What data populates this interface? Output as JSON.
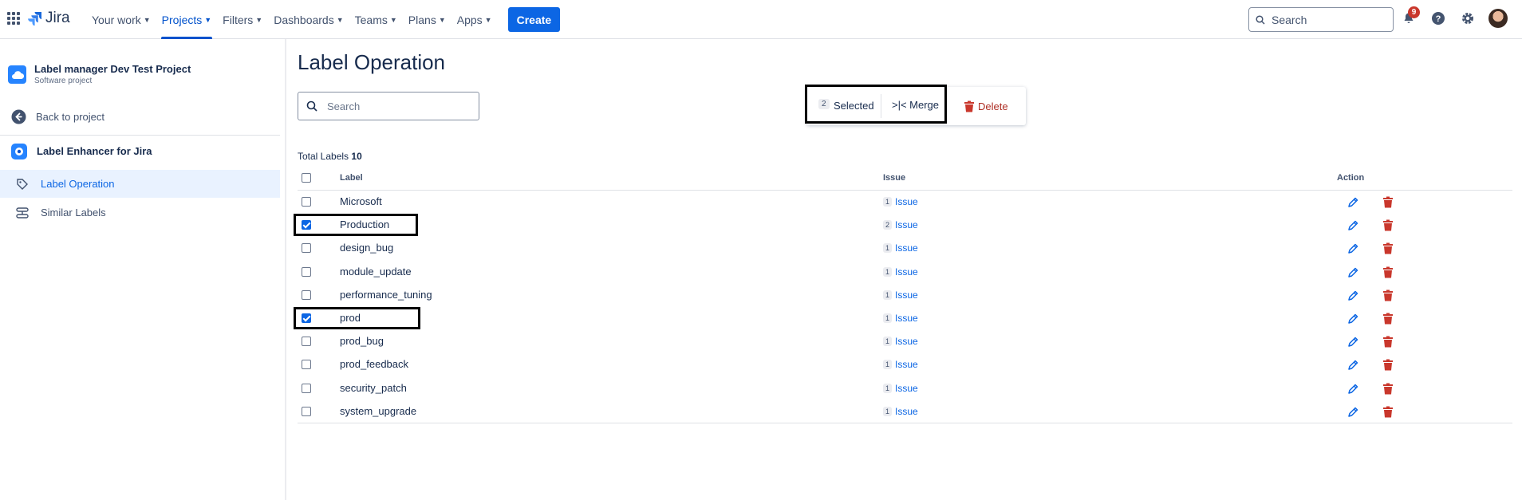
{
  "topnav": {
    "logo_text": "Jira",
    "items": [
      {
        "label": "Your work"
      },
      {
        "label": "Projects"
      },
      {
        "label": "Filters"
      },
      {
        "label": "Dashboards"
      },
      {
        "label": "Teams"
      },
      {
        "label": "Plans"
      },
      {
        "label": "Apps"
      }
    ],
    "active_item": "Projects",
    "create_label": "Create",
    "search_placeholder": "Search",
    "notification_count": "9",
    "accent_color": "#0c66e4"
  },
  "sidebar": {
    "project_name": "Label manager Dev Test Project",
    "project_type": "Software project",
    "back_label": "Back to project",
    "app_name": "Label Enhancer for Jira",
    "items": [
      {
        "label": "Label Operation",
        "icon": "label-tag-icon",
        "active": true
      },
      {
        "label": "Similar Labels",
        "icon": "stack-icon",
        "active": false
      }
    ]
  },
  "main": {
    "title": "Label Operation",
    "search_placeholder": "Search",
    "bulk": {
      "selected_count": "2",
      "selected_label": "Selected",
      "merge_label": ">|< Merge",
      "delete_label": "Delete"
    },
    "total_label": "Total Labels",
    "total_count": "10",
    "columns": {
      "label": "Label",
      "issue": "Issue",
      "action": "Action"
    },
    "rows": [
      {
        "label": "Microsoft",
        "count": "1",
        "issue_text": "Issue",
        "checked": false
      },
      {
        "label": "Production",
        "count": "2",
        "issue_text": "Issue",
        "checked": true
      },
      {
        "label": "design_bug",
        "count": "1",
        "issue_text": "Issue",
        "checked": false
      },
      {
        "label": "module_update",
        "count": "1",
        "issue_text": "Issue",
        "checked": false
      },
      {
        "label": "performance_tuning",
        "count": "1",
        "issue_text": "Issue",
        "checked": false
      },
      {
        "label": "prod",
        "count": "1",
        "issue_text": "Issue",
        "checked": true
      },
      {
        "label": "prod_bug",
        "count": "1",
        "issue_text": "Issue",
        "checked": false
      },
      {
        "label": "prod_feedback",
        "count": "1",
        "issue_text": "Issue",
        "checked": false
      },
      {
        "label": "security_patch",
        "count": "1",
        "issue_text": "Issue",
        "checked": false
      },
      {
        "label": "system_upgrade",
        "count": "1",
        "issue_text": "Issue",
        "checked": false
      }
    ],
    "delete_color": "#c9372c",
    "edit_color": "#0c66e4"
  }
}
